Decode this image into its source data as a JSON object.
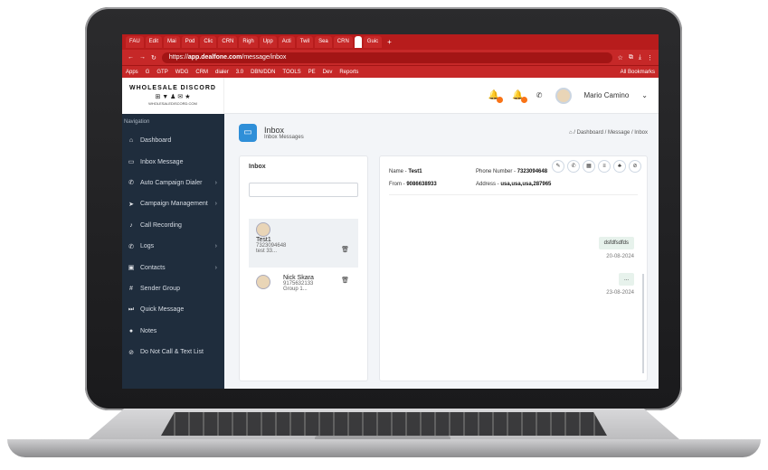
{
  "browser": {
    "tabs": [
      "FAU",
      "Edit",
      "Mai",
      "Pod",
      "Clic",
      "CRN",
      "Righ",
      "Upp",
      "Acti",
      "Twil",
      "Sea",
      "CRN",
      "",
      "Guic"
    ],
    "active_tab_index": 12,
    "url_prefix": "https://",
    "url_host": "app.dealfone.com",
    "url_path": "/message/inbox",
    "bookmarks": [
      "Apps",
      "G",
      "GTP",
      "WDG",
      "CRM",
      "dialer",
      "3.0",
      "DBN/DDN",
      "TOOLS",
      "PE",
      "Dev",
      "Reports"
    ],
    "all_bookmarks": "All Bookmarks"
  },
  "logo": {
    "line1": "WHOLESALE DISCORD",
    "line2": "⊞ ▼ ♟ ✉ ★",
    "line3": "WHOLESALEDISCORD.COM"
  },
  "header": {
    "user_name": "Mario Camino"
  },
  "sidebar": {
    "title": "Navigation",
    "items": [
      {
        "label": "Dashboard",
        "icon": "home-icon",
        "glyph": "⌂",
        "chevron": ""
      },
      {
        "label": "Inbox Message",
        "icon": "inbox-icon",
        "glyph": "▭",
        "chevron": ""
      },
      {
        "label": "Auto Campaign Dialer",
        "icon": "phone-icon",
        "glyph": "✆",
        "chevron": "›"
      },
      {
        "label": "Campaign Management",
        "icon": "send-icon",
        "glyph": "➤",
        "chevron": "›"
      },
      {
        "label": "Call Recording",
        "icon": "mic-icon",
        "glyph": "♪",
        "chevron": ""
      },
      {
        "label": "Logs",
        "icon": "phone-log-icon",
        "glyph": "✆",
        "chevron": "›"
      },
      {
        "label": "Contacts",
        "icon": "contacts-icon",
        "glyph": "▣",
        "chevron": "›"
      },
      {
        "label": "Sender Group",
        "icon": "hash-icon",
        "glyph": "#",
        "chevron": ""
      },
      {
        "label": "Quick Message",
        "icon": "fast-forward-icon",
        "glyph": "⏭",
        "chevron": ""
      },
      {
        "label": "Notes",
        "icon": "chat-icon",
        "glyph": "●",
        "chevron": ""
      },
      {
        "label": "Do Not Call & Text List",
        "icon": "block-icon",
        "glyph": "⊘",
        "chevron": ""
      }
    ]
  },
  "page": {
    "title": "Inbox",
    "subtitle": "Inbox Messages",
    "breadcrumb": "⌂ / Dashboard / Message / Inbox"
  },
  "inbox": {
    "heading": "Inbox",
    "contacts": [
      {
        "name": "Test1",
        "phone": "7323094648",
        "preview": "test 33..."
      },
      {
        "name": "Nick Skara",
        "phone": "9175632133",
        "preview": "Group 1..."
      }
    ]
  },
  "conversation": {
    "name_label": "Name - ",
    "name": "Test1",
    "phone_label": "Phone Number - ",
    "phone": "7323094648",
    "from_label": "From - ",
    "from": "9086638933",
    "address_label": "Address - ",
    "address": "usa,usa,usa,287965",
    "messages": [
      {
        "text": "dsfdfsdfds",
        "date": "20-08-2024"
      },
      {
        "text": "...",
        "date": "23-08-2024"
      }
    ]
  }
}
